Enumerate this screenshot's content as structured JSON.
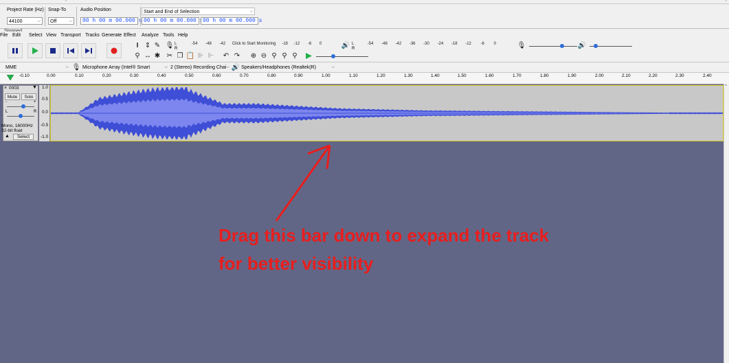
{
  "selection_toolbar": {
    "project_rate_label": "Project Rate (Hz)",
    "project_rate_value": "44100",
    "snap_to_label": "Snap-To",
    "snap_to_value": "Off",
    "audio_position_label": "Audio Position",
    "audio_position_value": "00 h 00 m 00.000 s",
    "selection_label": "Start and End of Selection",
    "selection_start": "00 h 00 m 00.000 s",
    "selection_end": "00 h 00 m 00.000 s"
  },
  "status": "Stopped",
  "menu": [
    "File",
    "Edit",
    "Select",
    "View",
    "Transport",
    "Tracks",
    "Generate",
    "Effect",
    "Analyze",
    "Tools",
    "Help"
  ],
  "transport": {
    "pause_icon": "pause-icon",
    "play_icon": "play-icon",
    "stop_icon": "stop-icon",
    "skip_start_icon": "skip-to-start-icon",
    "skip_end_icon": "skip-to-end-icon",
    "record_icon": "record-icon"
  },
  "meters": {
    "record_scale": [
      "-54",
      "-48",
      "-42",
      "Click to Start Monitoring",
      "-18",
      "-12",
      "-6",
      "0"
    ],
    "play_scale": [
      "-54",
      "-48",
      "-42",
      "-36",
      "-30",
      "-24",
      "-18",
      "-12",
      "-6",
      "0"
    ],
    "lr_top": "L",
    "lr_bottom": "R"
  },
  "devices": {
    "host": "MME",
    "recording_device": "Microphone Array (Intel® Smart",
    "channels": "2 (Stereo) Recording Chai",
    "playback_device": "Speakers/Headphones (Realtek(R)"
  },
  "ruler": {
    "ticks": [
      "-0.10",
      "0.00",
      "0.10",
      "0.20",
      "0.30",
      "0.40",
      "0.50",
      "0.60",
      "0.70",
      "0.80",
      "0.90",
      "1.00",
      "1.10",
      "1.20",
      "1.30",
      "1.40",
      "1.50",
      "1.60",
      "1.70",
      "1.80",
      "1.90",
      "2.00",
      "2.10",
      "2.20",
      "2.30",
      "2.40"
    ]
  },
  "track": {
    "name": "0003",
    "mute_label": "Mute",
    "solo_label": "Solo",
    "gain_minus": "-",
    "gain_plus": "+",
    "pan_left": "L",
    "pan_right": "R",
    "info_line1": "Mono, 16000Hz",
    "info_line2": "32-bit float",
    "select_label": "Select",
    "scale": [
      "1.0",
      "0.5",
      "0.0",
      "-0.5",
      "-1.0"
    ]
  },
  "annotation": {
    "line1": "Drag this bar down to expand the track",
    "line2": "for better visibility",
    "color": "#e81e1e"
  }
}
